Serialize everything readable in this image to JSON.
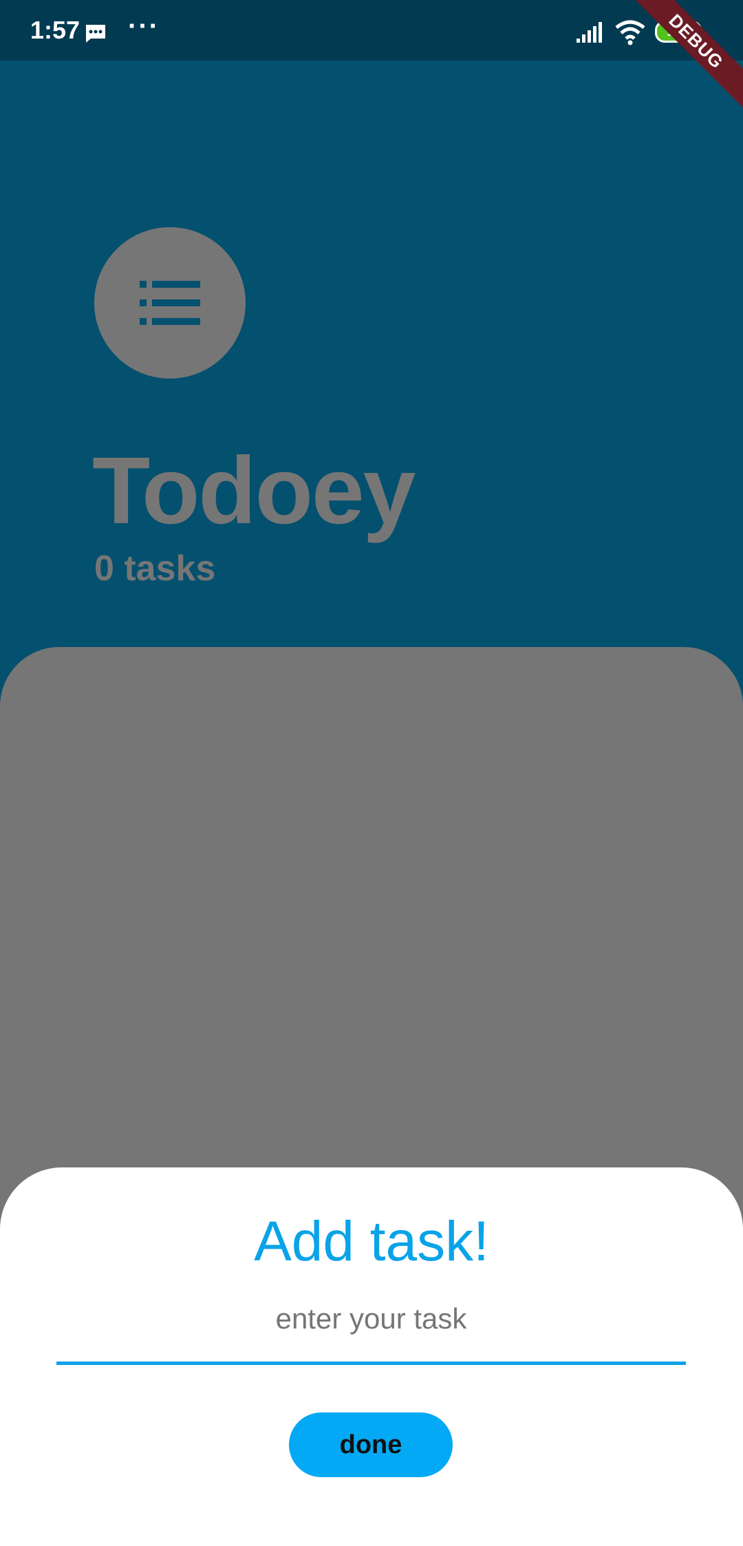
{
  "status_bar": {
    "time": "1:57",
    "more_indicator": "···",
    "battery_level": "100",
    "battery_color": "#53c21d",
    "icons": [
      "message-icon",
      "signal-icon",
      "wifi-icon",
      "battery-icon"
    ]
  },
  "debug_banner": {
    "label": "DEBUG"
  },
  "header": {
    "icon": "list-icon",
    "title": "Todoey",
    "task_count": "0 tasks"
  },
  "add_task_sheet": {
    "title": "Add task!",
    "input_value": "",
    "input_placeholder": "enter your task",
    "done_label": "done"
  },
  "colors": {
    "background": "#04506f",
    "status_bar": "#023a52",
    "dim_gray": "#767676",
    "accent": "#0aa3e8",
    "button": "#03a9f4"
  }
}
